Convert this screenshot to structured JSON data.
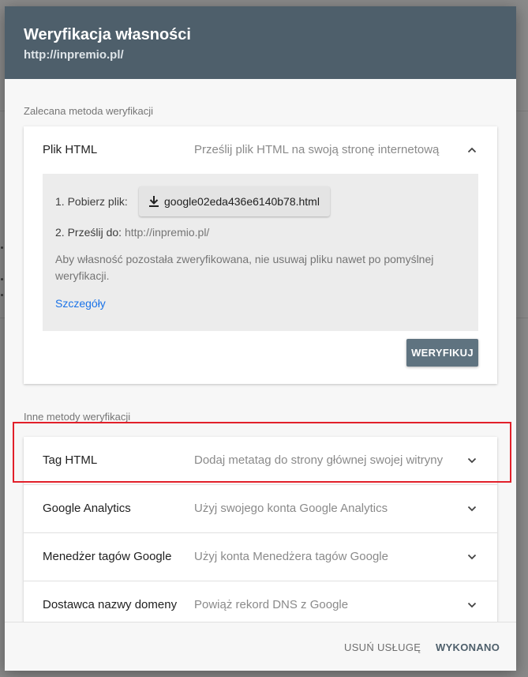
{
  "dialog": {
    "title": "Weryfikacja własności",
    "subtitle": "http://inpremio.pl/"
  },
  "recommended": {
    "section_label": "Zalecana metoda weryfikacji",
    "method": {
      "name": "Plik HTML",
      "description": "Prześlij plik HTML na swoją stronę internetową",
      "expanded": true,
      "step1_label": "1. Pobierz plik:",
      "download_file": "google02eda436e6140b78.html",
      "download_icon": "download-icon",
      "step2_label": "2. Prześlij do:",
      "step2_url": "http://inpremio.pl/",
      "note": "Aby własność pozostała zweryfikowana, nie usuwaj pliku nawet po pomyślnej weryfikacji.",
      "details_link": "Szczegóły",
      "verify_button": "WERYFIKUJ"
    }
  },
  "other": {
    "section_label": "Inne metody weryfikacji",
    "methods": [
      {
        "name": "Tag HTML",
        "description": "Dodaj metatag do strony głównej swojej witryny",
        "highlighted": true
      },
      {
        "name": "Google Analytics",
        "description": "Użyj swojego konta Google Analytics"
      },
      {
        "name": "Menedżer tagów Google",
        "description": "Użyj konta Menedżera tagów Google"
      },
      {
        "name": "Dostawca nazwy domeny",
        "description": "Powiąż rekord DNS z Google"
      }
    ]
  },
  "footer": {
    "remove_button": "USUŃ USŁUGĘ",
    "done_button": "WYKONANO"
  },
  "colors": {
    "header_bg": "#4e5f6b",
    "verify_button_bg": "#5f7380",
    "link": "#1a73e8",
    "highlight_border": "#e2202a"
  }
}
